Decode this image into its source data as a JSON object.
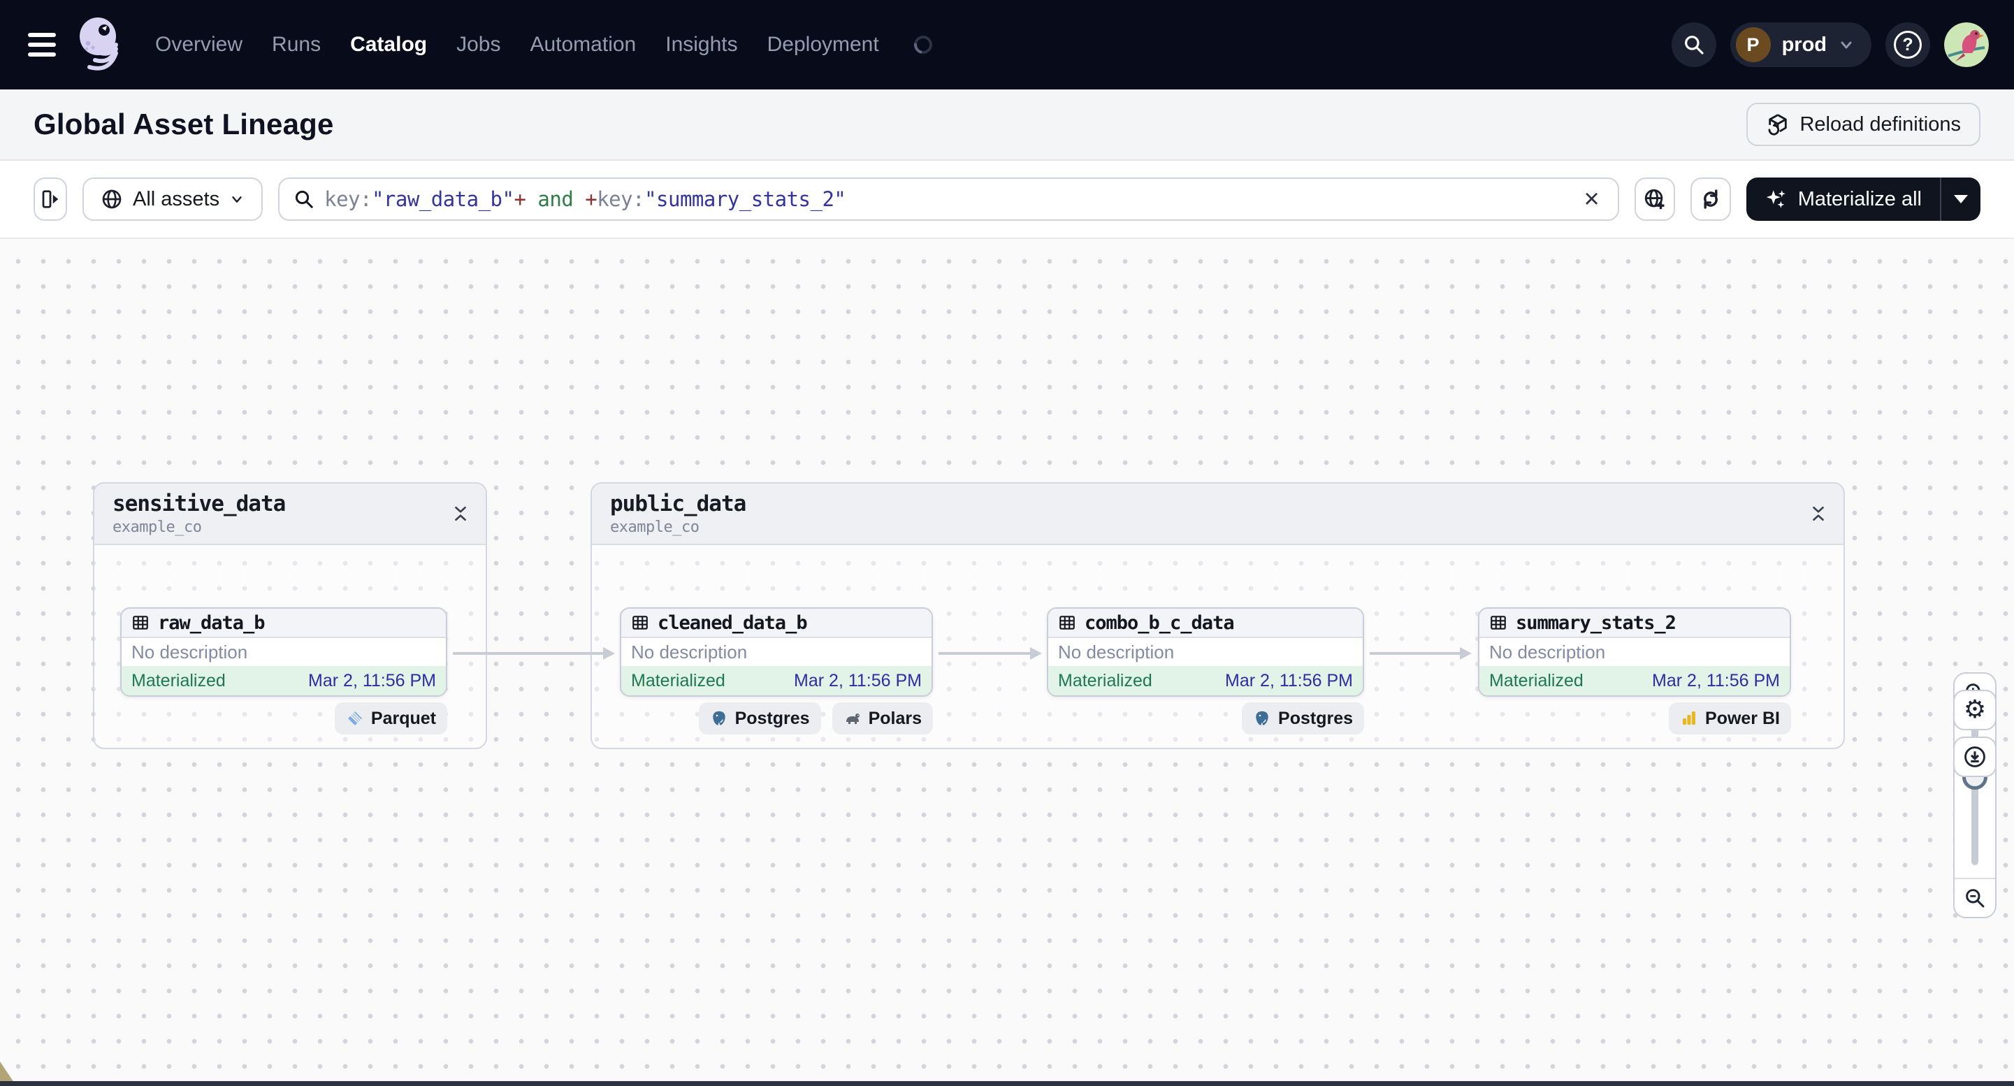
{
  "colors": {
    "nav_bg": "#070b1a",
    "materialize_bg": "#10141f",
    "status_green": "#1e7a4e",
    "timestamp_blue": "#2e2ea3",
    "query_field_gray": "#7b8294",
    "query_value_indigo": "#34349e",
    "query_plus_red": "#8f3131",
    "query_and_green": "#2e7d46",
    "powerbi_yellow": "#e9b71c",
    "postgres_blue": "#3c6e98",
    "parquet_blue": "#6fa3d9"
  },
  "topnav": {
    "links": [
      {
        "label": "Overview",
        "active": false
      },
      {
        "label": "Runs",
        "active": false
      },
      {
        "label": "Catalog",
        "active": true
      },
      {
        "label": "Jobs",
        "active": false
      },
      {
        "label": "Automation",
        "active": false
      },
      {
        "label": "Insights",
        "active": false
      },
      {
        "label": "Deployment",
        "active": false
      }
    ],
    "environment": {
      "abbrev": "P",
      "name": "prod"
    },
    "help_glyph": "?"
  },
  "header": {
    "title": "Global Asset Lineage",
    "reload_button": "Reload definitions"
  },
  "toolbar": {
    "scope": "All assets",
    "query": {
      "segments": [
        {
          "text": "key:",
          "type": "field"
        },
        {
          "text": "\"raw_data_b\"",
          "type": "value"
        },
        {
          "text": "+",
          "type": "plus"
        },
        {
          "text": " and ",
          "type": "and"
        },
        {
          "text": "+",
          "type": "plus"
        },
        {
          "text": "key:",
          "type": "field"
        },
        {
          "text": "\"summary_stats_2\"",
          "type": "value"
        }
      ]
    },
    "clear_glyph": "×",
    "materialize": "Materialize all"
  },
  "graph": {
    "groups": [
      {
        "name": "sensitive_data",
        "location": "example_co",
        "assets": [
          {
            "name": "raw_data_b",
            "description": "No description",
            "status": "Materialized",
            "materialized_at": "Mar 2, 11:56 PM",
            "tags": [
              {
                "label": "Parquet",
                "icon": "parquet-icon"
              }
            ]
          }
        ]
      },
      {
        "name": "public_data",
        "location": "example_co",
        "assets": [
          {
            "name": "cleaned_data_b",
            "description": "No description",
            "status": "Materialized",
            "materialized_at": "Mar 2, 11:56 PM",
            "tags": [
              {
                "label": "Postgres",
                "icon": "postgres-icon"
              },
              {
                "label": "Polars",
                "icon": "polars-icon"
              }
            ]
          },
          {
            "name": "combo_b_c_data",
            "description": "No description",
            "status": "Materialized",
            "materialized_at": "Mar 2, 11:56 PM",
            "tags": [
              {
                "label": "Postgres",
                "icon": "postgres-icon"
              }
            ]
          },
          {
            "name": "summary_stats_2",
            "description": "No description",
            "status": "Materialized",
            "materialized_at": "Mar 2, 11:56 PM",
            "tags": [
              {
                "label": "Power BI",
                "icon": "powerbi-icon"
              }
            ]
          }
        ]
      }
    ]
  }
}
